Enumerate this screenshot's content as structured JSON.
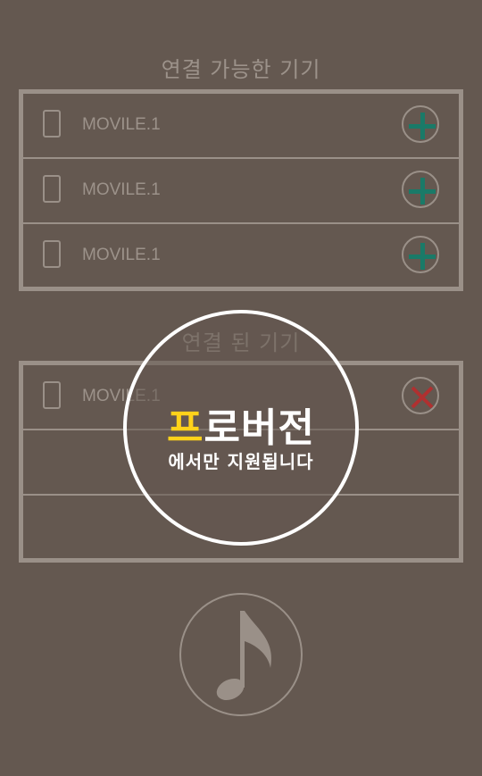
{
  "available": {
    "title": "연결 가능한 기기",
    "devices": [
      {
        "label": "MOVILE.1",
        "action": "plus-icon"
      },
      {
        "label": "MOVILE.1",
        "action": "plus-icon"
      },
      {
        "label": "MOVILE.1",
        "action": "plus-icon"
      }
    ]
  },
  "connected": {
    "title": "연결 된 기기",
    "devices": [
      {
        "label": "MOVILE.1",
        "action": "close-icon"
      }
    ]
  },
  "pro_overlay": {
    "title_highlight": "프",
    "title_rest": "로버전",
    "subtitle": "에서만 지원됩니다"
  },
  "colors": {
    "background": "#645850",
    "line": "#9a9088",
    "text": "#9c928a",
    "plus": "#1a7a68",
    "close": "#b03030",
    "highlight": "#ffd21a"
  },
  "icons": {
    "device": "phone-icon",
    "music": "music-note-icon"
  }
}
